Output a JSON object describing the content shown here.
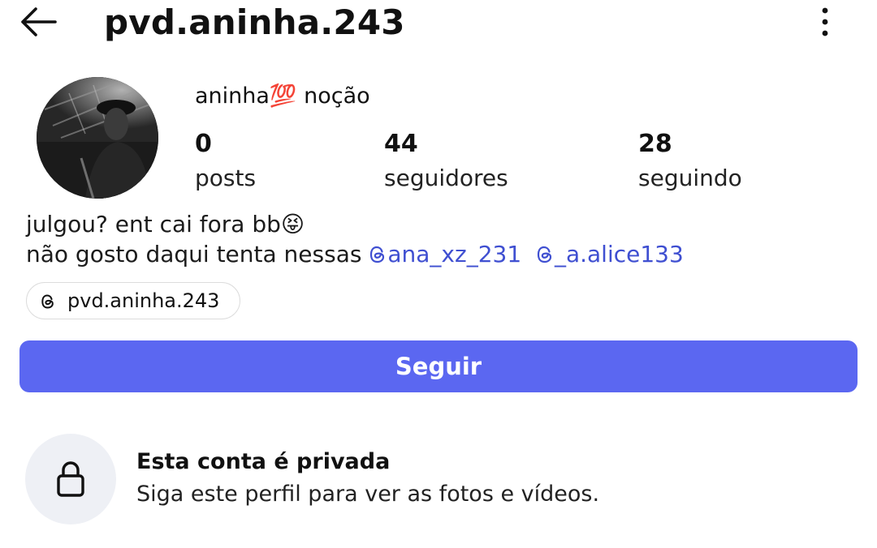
{
  "header": {
    "title": "pvd.aninha.243",
    "back_icon": "arrow-left-icon",
    "more_icon": "more-vertical-icon"
  },
  "profile": {
    "avatar_icon": "avatar",
    "display_name": "aninha💯 noção",
    "stats": [
      {
        "value": "0",
        "label": "posts"
      },
      {
        "value": "44",
        "label": "seguidores"
      },
      {
        "value": "28",
        "label": "seguindo"
      }
    ],
    "bio_line_1": "julgou? ent cai fora bb😝",
    "bio_line_2_text": "não gosto daqui tenta nessas ",
    "mentions": [
      "ana_xz_231",
      "_a.alice133"
    ],
    "threads_chip_label": "pvd.aninha.243",
    "threads_icon": "threads-icon"
  },
  "actions": {
    "follow_label": "Seguir"
  },
  "private_notice": {
    "title": "Esta conta é privada",
    "subtitle": "Siga este perfil para ver as fotos e vídeos.",
    "icon": "lock-icon"
  },
  "colors": {
    "accent": "#5b67f1",
    "link": "#3f4fd1",
    "lock_bg": "#eef0f5"
  }
}
